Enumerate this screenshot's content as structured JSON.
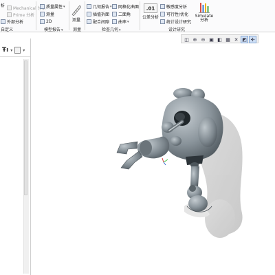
{
  "ribbon": {
    "left_column": [
      "析",
      "定义",
      "外部分析"
    ],
    "col2": [
      "Mechanical 分析",
      "Prime 分析"
    ],
    "col3": [
      "质量属性",
      "测量",
      "2D"
    ],
    "measure": {
      "label": "测量"
    },
    "col4": [
      "几何报告",
      "插值拆面",
      "配合间隙"
    ],
    "col5": [
      "网格化曲面",
      "二面角",
      "曲率"
    ],
    "tolerance": {
      "label": "公差分析",
      "value": ".01"
    },
    "col6": [
      "敏感度分析",
      "可行性/优化",
      "统计设计研究"
    ],
    "simulate": {
      "label": "Simulate 分析"
    },
    "groups": {
      "custom": "自定义",
      "model_report": "模型报告",
      "measure": "测量",
      "inspect_geometry": "检查几何",
      "design_study": "设计研究"
    }
  },
  "view_toolbar": {
    "buttons": [
      "zoom-fit",
      "zoom-in",
      "zoom-out",
      "refit",
      "view-manager",
      "saved-orientations",
      "display-style",
      "datum-display",
      "spin-center"
    ]
  },
  "model_colors": {
    "body": "#7f8a92",
    "highlight": "#b7c0c6",
    "shadow": "#cfcfcf",
    "dark": "#2b3338"
  }
}
